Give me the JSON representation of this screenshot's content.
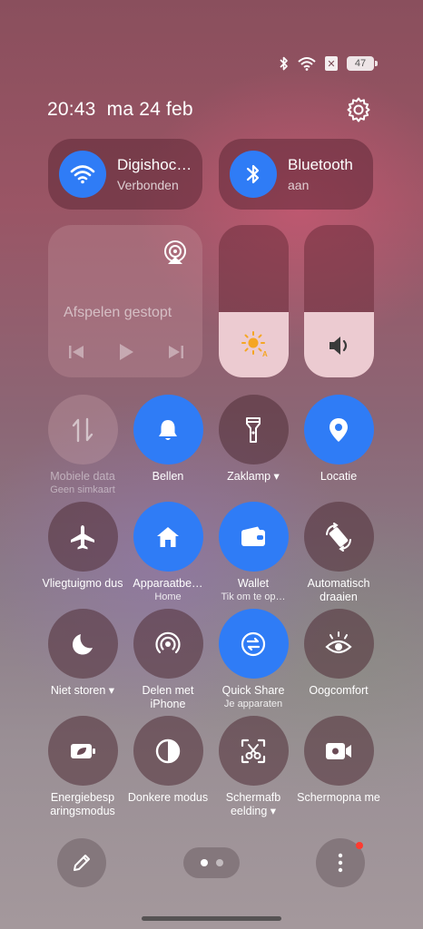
{
  "status_bar": {
    "battery": "47"
  },
  "header": {
    "clock": "20:43  ma 24 feb"
  },
  "wifi_pill": {
    "name": "Digishoc…",
    "status": "Verbonden"
  },
  "bluetooth_pill": {
    "name": "Bluetooth",
    "status": "aan"
  },
  "media": {
    "status": "Afspelen gestopt"
  },
  "brightness": {
    "level": 0.43
  },
  "volume": {
    "level": 0.43
  },
  "tiles": {
    "mobile_data": {
      "label": "Mobiele data",
      "sub": "Geen simkaart"
    },
    "ring": {
      "label": "Bellen"
    },
    "flashlight": {
      "label": "Zaklamp ▾"
    },
    "location": {
      "label": "Locatie"
    },
    "airplane": {
      "label": "Vliegtuigmo dus"
    },
    "device_control": {
      "label": "Apparaatbe…",
      "sub": "Home"
    },
    "wallet": {
      "label": "Wallet",
      "sub": "Tik om te op…"
    },
    "auto_rotate": {
      "label": "Automatisch draaien"
    },
    "dnd": {
      "label": "Niet storen ▾"
    },
    "share_iphone": {
      "label": "Delen met iPhone"
    },
    "quick_share": {
      "label": "Quick Share",
      "sub": "Je apparaten"
    },
    "eye_comfort": {
      "label": "Oogcomfort"
    },
    "power_saving": {
      "label": "Energiebesp aringsmodus"
    },
    "dark_mode": {
      "label": "Donkere modus"
    },
    "screenshot": {
      "label": "Schermafb eelding ▾"
    },
    "screen_record": {
      "label": "Schermopna me"
    }
  },
  "colors": {
    "accent": "#2f7cf6",
    "notification_dot": "#ff3b30"
  }
}
